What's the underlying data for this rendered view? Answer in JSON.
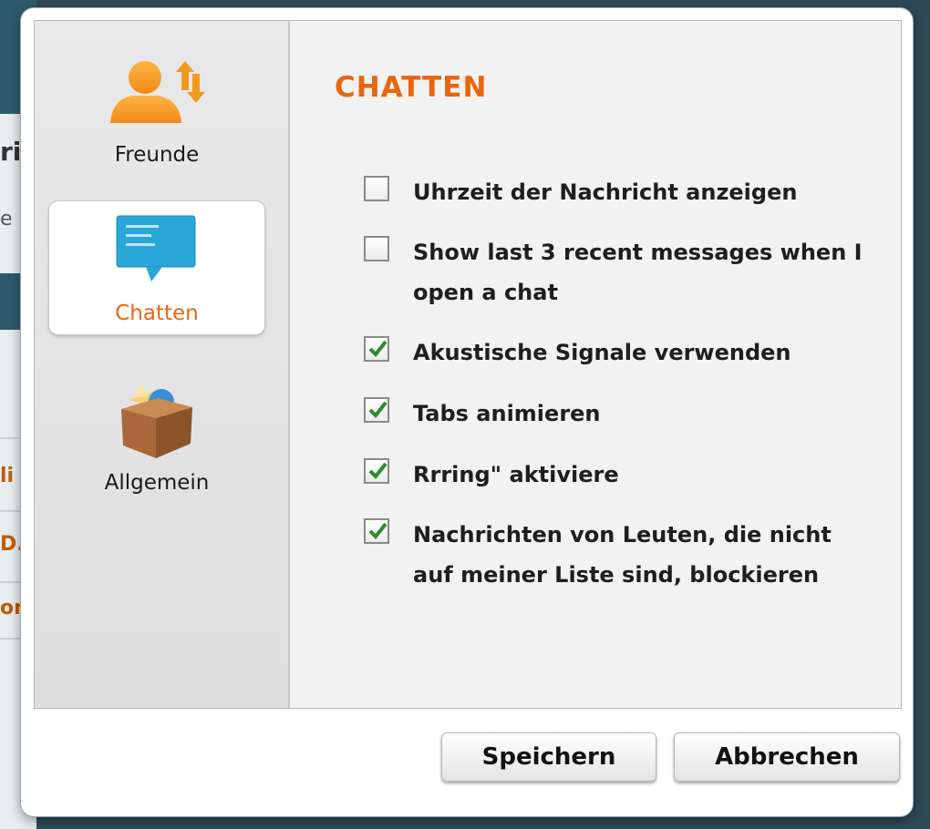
{
  "background_fragments": [
    "ri",
    "e",
    "li",
    "D.",
    "on"
  ],
  "sidebar": {
    "items": [
      {
        "label": "Freunde",
        "icon": "friends-icon",
        "active": false
      },
      {
        "label": "Chatten",
        "icon": "chat-bubble-icon",
        "active": true
      },
      {
        "label": "Allgemein",
        "icon": "box-icon",
        "active": false
      }
    ]
  },
  "main": {
    "title": "CHATTEN",
    "options": [
      {
        "label": "Uhrzeit der Nachricht anzeigen",
        "checked": false
      },
      {
        "label": "Show last 3 recent messages when I open a chat",
        "checked": false
      },
      {
        "label": "Akustische Signale verwenden",
        "checked": true
      },
      {
        "label": "Tabs animieren",
        "checked": true
      },
      {
        "label": "Rrring\" aktiviere",
        "checked": true
      },
      {
        "label": "Nachrichten von Leuten, die nicht auf meiner Liste sind, blockieren",
        "checked": true
      }
    ]
  },
  "buttons": {
    "save_label": "Speichern",
    "cancel_label": "Abbrechen"
  },
  "colors": {
    "accent": "#e8660e",
    "check": "#2e8b2e",
    "chat_icon": "#2aa7d8"
  }
}
